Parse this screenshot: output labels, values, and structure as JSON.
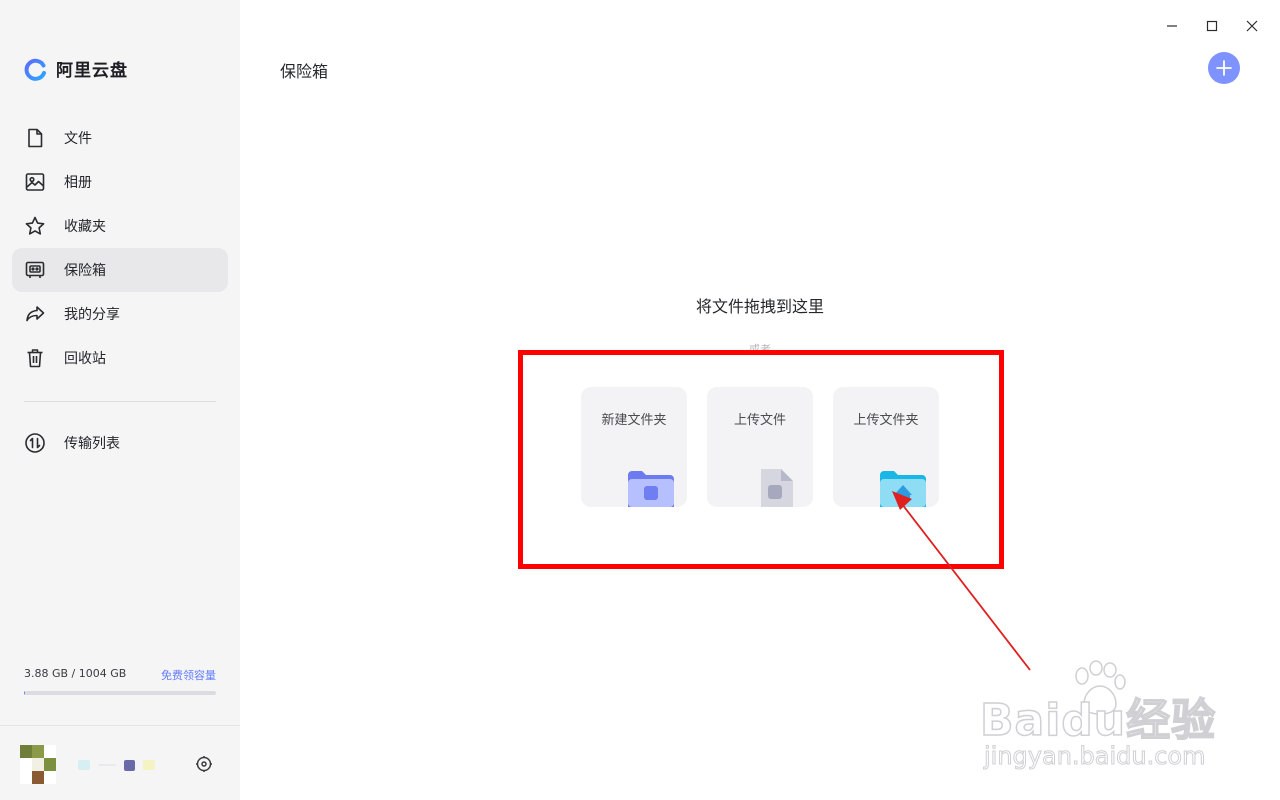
{
  "app": {
    "logo_text": "阿里云盘"
  },
  "sidebar": {
    "items": [
      {
        "label": "文件",
        "icon": "file-icon",
        "active": false
      },
      {
        "label": "相册",
        "icon": "photo-icon",
        "active": false
      },
      {
        "label": "收藏夹",
        "icon": "star-icon",
        "active": false
      },
      {
        "label": "保险箱",
        "icon": "safe-icon",
        "active": true
      },
      {
        "label": "我的分享",
        "icon": "share-icon",
        "active": false
      },
      {
        "label": "回收站",
        "icon": "trash-icon",
        "active": false
      }
    ],
    "transfer": {
      "label": "传输列表",
      "icon": "transfer-icon"
    },
    "storage": {
      "usage_text": "3.88 GB / 1004 GB",
      "upgrade_link": "免费领容量",
      "used_fraction": 0.004
    },
    "accent_color": "#637dff"
  },
  "main": {
    "title": "保险箱",
    "drop_zone": {
      "title": "将文件拖拽到这里",
      "or_text": "或者",
      "cards": [
        {
          "label": "新建文件夹",
          "icon": "new-folder-icon"
        },
        {
          "label": "上传文件",
          "icon": "upload-file-icon"
        },
        {
          "label": "上传文件夹",
          "icon": "upload-folder-icon"
        }
      ]
    }
  },
  "annotation": {
    "box_color": "#ff0000",
    "arrow_color": "#e02020"
  },
  "watermark": {
    "main": "Baidu经验",
    "sub": "jingyan.baidu.com"
  }
}
